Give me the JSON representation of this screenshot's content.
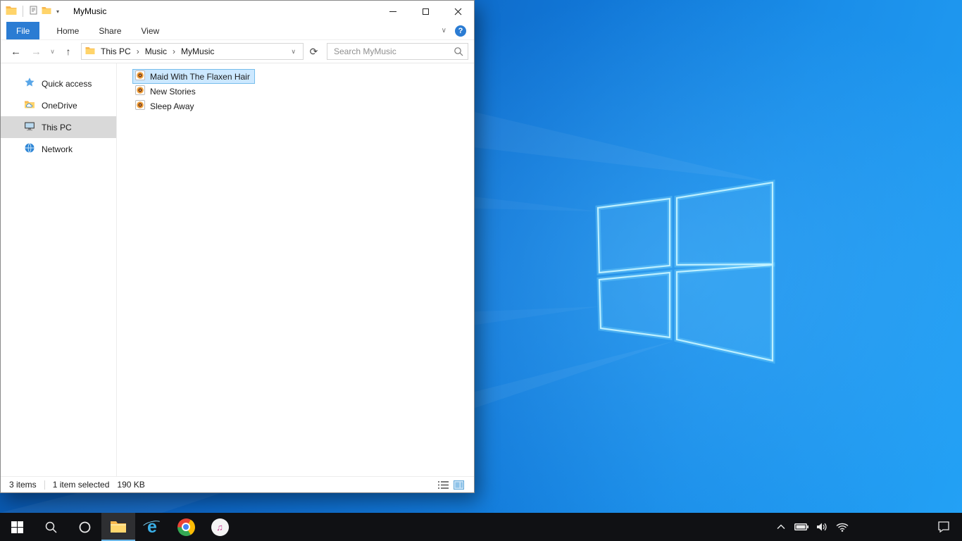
{
  "explorer": {
    "title": "MyMusic",
    "tabs": [
      {
        "label": "File"
      },
      {
        "label": "Home"
      },
      {
        "label": "Share"
      },
      {
        "label": "View"
      }
    ],
    "nav": {
      "back": "←",
      "forward": "→",
      "recent": "∨",
      "up": "↑"
    },
    "breadcrumb": [
      "This PC",
      "Music",
      "MyMusic"
    ],
    "breadcrumb_sep": "›",
    "address_dropdown": "∨",
    "refresh": "⟳",
    "search_placeholder": "Search MyMusic",
    "ribbon_collapse": "∨",
    "help": "?",
    "qat_chevron": "▾",
    "sidebar": [
      {
        "label": "Quick access",
        "icon": "star-icon"
      },
      {
        "label": "OneDrive",
        "icon": "onedrive-folder-icon"
      },
      {
        "label": "This PC",
        "icon": "monitor-icon",
        "selected": true
      },
      {
        "label": "Network",
        "icon": "globe-icon"
      }
    ],
    "files": [
      {
        "name": "Maid With The Flaxen Hair",
        "icon": "music-file-icon",
        "selected": true
      },
      {
        "name": "New Stories",
        "icon": "music-file-icon"
      },
      {
        "name": "Sleep Away",
        "icon": "music-file-icon"
      }
    ],
    "status": {
      "count": "3 items",
      "selection": "1 item selected",
      "size": "190 KB"
    }
  },
  "taskbar": {
    "ie_glyph": "e",
    "itunes_glyph": "♫"
  },
  "colors": {
    "accent": "#2b7cd3",
    "file_tab_bg": "#2b7cd3",
    "selection_bg": "#cce8ff",
    "selection_border": "#77bdeb",
    "sidebar_selected_bg": "#d9d9d9",
    "taskbar_bg": "#101114",
    "desktop_blue_dark": "#0750a2",
    "desktop_blue_light": "#23a1f5"
  }
}
